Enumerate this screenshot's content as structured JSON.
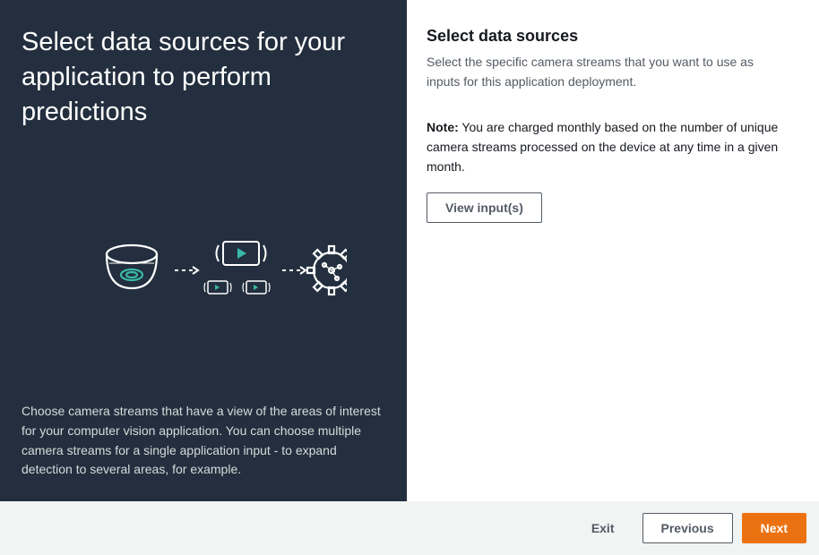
{
  "left": {
    "title": "Select data sources for your application to perform predictions",
    "description": "Choose camera streams that have a view of the areas of interest for your computer vision application. You can choose multiple camera streams for a single application input - to expand detection to several areas, for example."
  },
  "right": {
    "title": "Select data sources",
    "description": "Select the specific camera streams that you want to use as inputs for this application deployment.",
    "note_label": "Note:",
    "note_text": " You are charged monthly based on the number of unique camera streams processed on the device at any time in a given month.",
    "view_inputs_label": "View input(s)"
  },
  "footer": {
    "exit": "Exit",
    "previous": "Previous",
    "next": "Next"
  },
  "colors": {
    "panel_dark": "#232f3e",
    "accent_orange": "#ec7211",
    "teal": "#39b8a8"
  }
}
